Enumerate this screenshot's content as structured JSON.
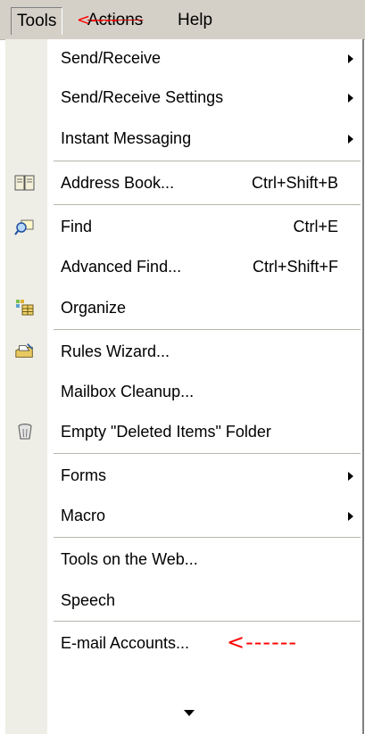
{
  "menubar": {
    "tools": "Tools",
    "actions": "Actions",
    "help": "Help",
    "annotation": "<----"
  },
  "menu": {
    "items": [
      {
        "label": "Send/Receive",
        "shortcut": "",
        "submenu": true,
        "icon": ""
      },
      {
        "label": "Send/Receive Settings",
        "shortcut": "",
        "submenu": true,
        "icon": ""
      },
      {
        "label": "Instant Messaging",
        "shortcut": "",
        "submenu": true,
        "icon": ""
      },
      {
        "label": "Address Book...",
        "shortcut": "Ctrl+Shift+B",
        "submenu": false,
        "icon": "address-book-icon"
      },
      {
        "label": "Find",
        "shortcut": "Ctrl+E",
        "submenu": false,
        "icon": "find-icon"
      },
      {
        "label": "Advanced Find...",
        "shortcut": "Ctrl+Shift+F",
        "submenu": false,
        "icon": ""
      },
      {
        "label": "Organize",
        "shortcut": "",
        "submenu": false,
        "icon": "organize-icon"
      },
      {
        "label": "Rules Wizard...",
        "shortcut": "",
        "submenu": false,
        "icon": "rules-wizard-icon"
      },
      {
        "label": "Mailbox Cleanup...",
        "shortcut": "",
        "submenu": false,
        "icon": ""
      },
      {
        "label": "Empty \"Deleted Items\" Folder",
        "shortcut": "",
        "submenu": false,
        "icon": "trash-icon"
      },
      {
        "label": "Forms",
        "shortcut": "",
        "submenu": true,
        "icon": ""
      },
      {
        "label": "Macro",
        "shortcut": "",
        "submenu": true,
        "icon": ""
      },
      {
        "label": "Tools on the Web...",
        "shortcut": "",
        "submenu": false,
        "icon": ""
      },
      {
        "label": "Speech",
        "shortcut": "",
        "submenu": false,
        "icon": ""
      },
      {
        "label": "E-mail Accounts...",
        "shortcut": "",
        "submenu": false,
        "icon": ""
      }
    ],
    "annotation": "<------"
  },
  "colors": {
    "menubar_bg": "#d4d0c8",
    "gutter_bg": "#efeee6",
    "annotation_red": "#ff0000"
  }
}
